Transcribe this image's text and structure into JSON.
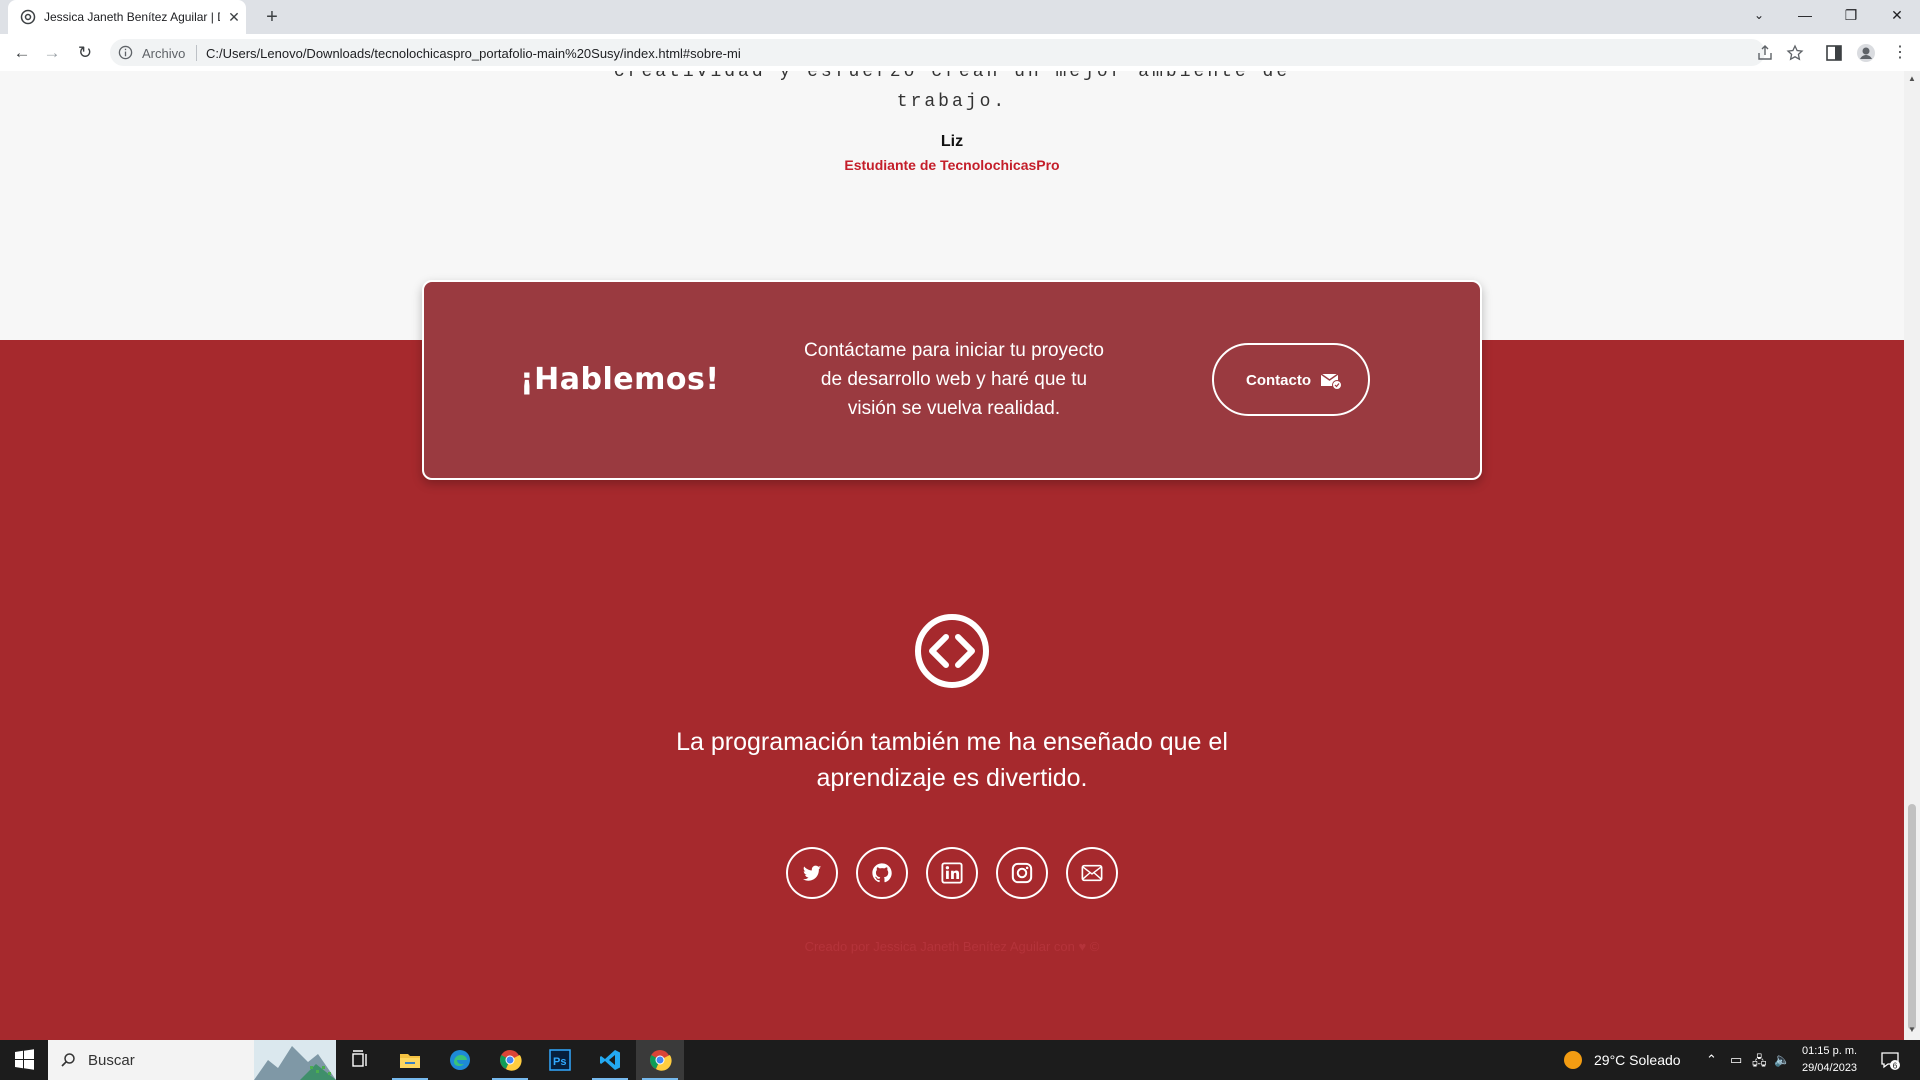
{
  "browser": {
    "tab_title": "Jessica Janeth Benítez Aguilar | D",
    "site_label": "Archivo",
    "url": "C:/Users/Lenovo/Downloads/tecnolochicaspro_portafolio-main%20Susy/index.html#sobre-mi",
    "window_controls": [
      "—",
      "❐",
      "✕"
    ]
  },
  "testimonial": {
    "line1": "creatividad y esfuerzo crean un mejor ambiente de",
    "line2": "trabajo.",
    "author": "Liz",
    "role": "Estudiante de TecnolochicasPro"
  },
  "cta": {
    "title": "¡Hablemos!",
    "text": "Contáctame para iniciar tu proyecto de desarrollo web y haré que tu visión se vuelva realidad.",
    "button_label": "Contacto"
  },
  "footer": {
    "tagline": "La programación también me ha enseñado que el aprendizaje es divertido.",
    "socials": [
      "twitter-icon",
      "github-icon",
      "linkedin-icon",
      "instagram-icon",
      "email-icon"
    ],
    "credit": "Creado por Jessica Janeth Benítez Aguilar con ♥ ©"
  },
  "colors": {
    "footer_bg": "#a6292d",
    "cta_bg": "#9a3a40",
    "accent_red": "#c41e2a"
  },
  "taskbar": {
    "search_placeholder": "Buscar",
    "weather": "29°C  Soleado",
    "time": "01:15 p. m.",
    "date": "29/04/2023",
    "notification_count": "6"
  }
}
